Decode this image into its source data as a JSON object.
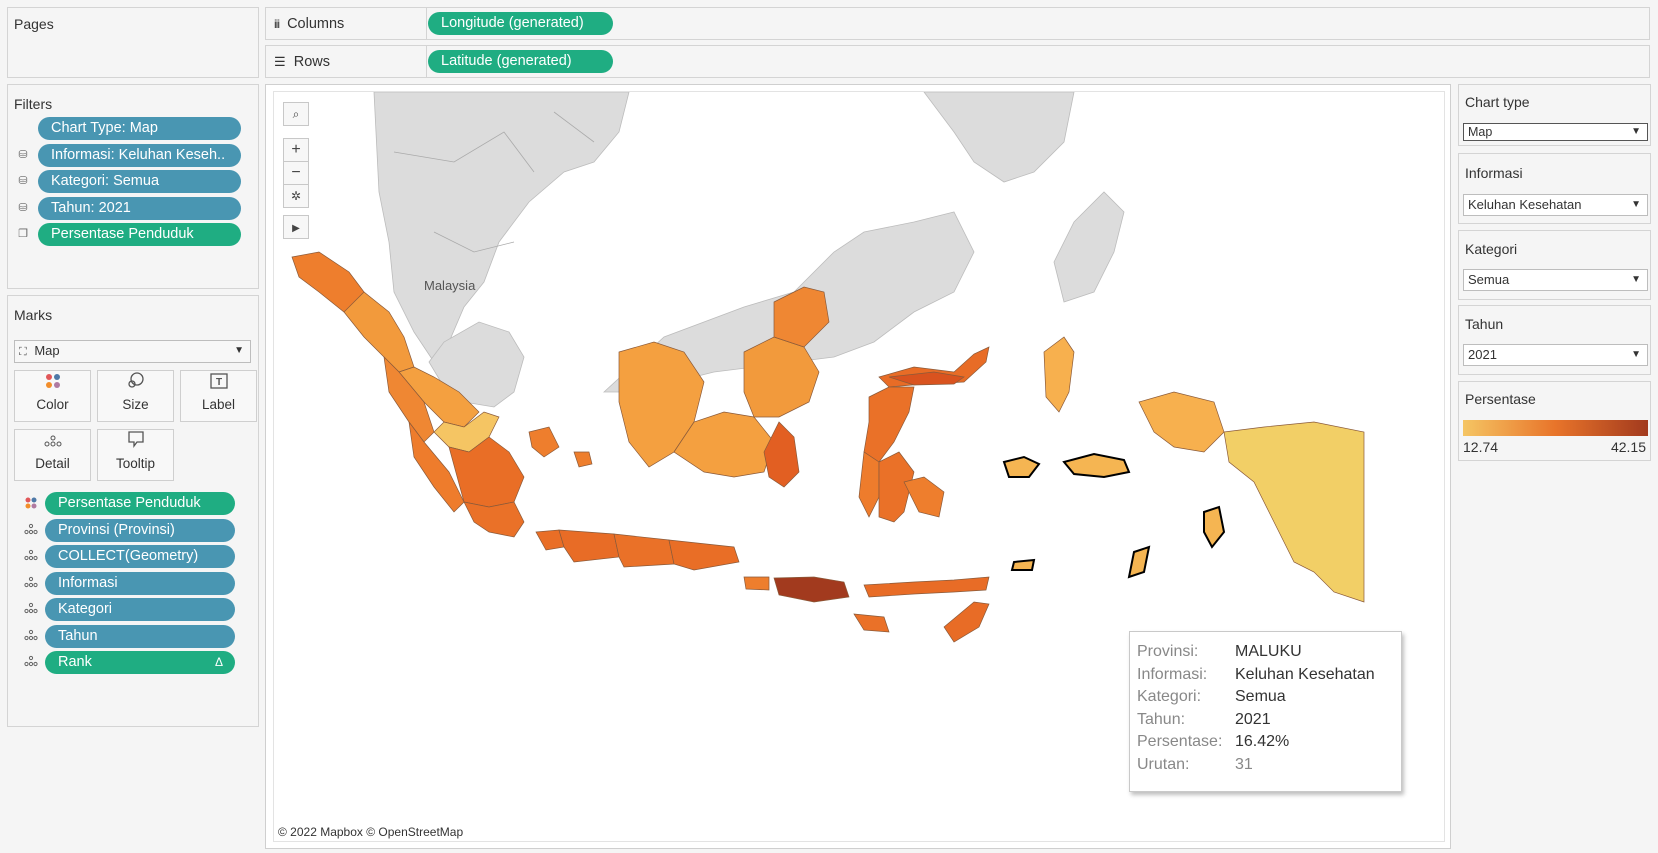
{
  "pages": {
    "title": "Pages"
  },
  "shelves": {
    "columns": {
      "icon": "columns-icon",
      "label": "Columns",
      "pill": "Longitude (generated)"
    },
    "rows": {
      "icon": "rows-icon",
      "label": "Rows",
      "pill": "Latitude (generated)"
    }
  },
  "filters": {
    "title": "Filters",
    "items": [
      {
        "label": "Chart Type: Map",
        "color": "blue",
        "icon": ""
      },
      {
        "label": "Informasi: Keluhan Keseh..",
        "color": "blue",
        "icon": "datasource-filter-icon"
      },
      {
        "label": "Kategori: Semua",
        "color": "blue",
        "icon": "datasource-filter-icon"
      },
      {
        "label": "Tahun: 2021",
        "color": "blue",
        "icon": "datasource-filter-icon"
      },
      {
        "label": "Persentase Penduduk",
        "color": "green",
        "icon": "sheets-filter-icon"
      }
    ]
  },
  "marks": {
    "title": "Marks",
    "type": "Map",
    "cards": [
      {
        "label": "Color",
        "icon": "color-icon"
      },
      {
        "label": "Size",
        "icon": "size-icon"
      },
      {
        "label": "Label",
        "icon": "label-icon"
      },
      {
        "label": "Detail",
        "icon": "detail-icon"
      },
      {
        "label": "Tooltip",
        "icon": "tooltip-icon"
      }
    ],
    "fields": [
      {
        "label": "Persentase Penduduk",
        "color": "green",
        "icon": "color-icon"
      },
      {
        "label": "Provinsi (Provinsi)",
        "color": "blue",
        "icon": "detail-icon"
      },
      {
        "label": "COLLECT(Geometry)",
        "color": "blue",
        "icon": "detail-icon"
      },
      {
        "label": "Informasi",
        "color": "blue",
        "icon": "detail-icon"
      },
      {
        "label": "Kategori",
        "color": "blue",
        "icon": "detail-icon"
      },
      {
        "label": "Tahun",
        "color": "blue",
        "icon": "detail-icon"
      },
      {
        "label": "Rank",
        "color": "green",
        "icon": "detail-icon",
        "suffix": "Δ"
      }
    ]
  },
  "parameters": [
    {
      "title": "Chart type",
      "value": "Map"
    },
    {
      "title": "Informasi",
      "value": "Keluhan Kesehatan"
    },
    {
      "title": "Kategori",
      "value": "Semua"
    },
    {
      "title": "Tahun",
      "value": "2021"
    }
  ],
  "legend": {
    "title": "Persentase",
    "min": "12.74",
    "max": "42.15",
    "color_low": "#f5c563",
    "color_mid": "#e8742a",
    "color_high": "#a23a1e"
  },
  "map": {
    "attribution": "© 2022 Mapbox © OpenStreetMap",
    "basemap_label": "Malaysia",
    "controls": [
      "search-icon",
      "zoom-in-icon",
      "zoom-out-icon",
      "reset-map-icon",
      "expand-toolbar-icon"
    ]
  },
  "tooltip": {
    "rows": [
      {
        "key": "Provinsi:",
        "value": "MALUKU"
      },
      {
        "key": "Informasi:",
        "value": "Keluhan Kesehatan"
      },
      {
        "key": "Kategori:",
        "value": "Semua"
      },
      {
        "key": "Tahun:",
        "value": "2021"
      },
      {
        "key": "Persentase:",
        "value": "16.42%"
      },
      {
        "key": "Urutan:",
        "value": "31"
      }
    ]
  }
}
